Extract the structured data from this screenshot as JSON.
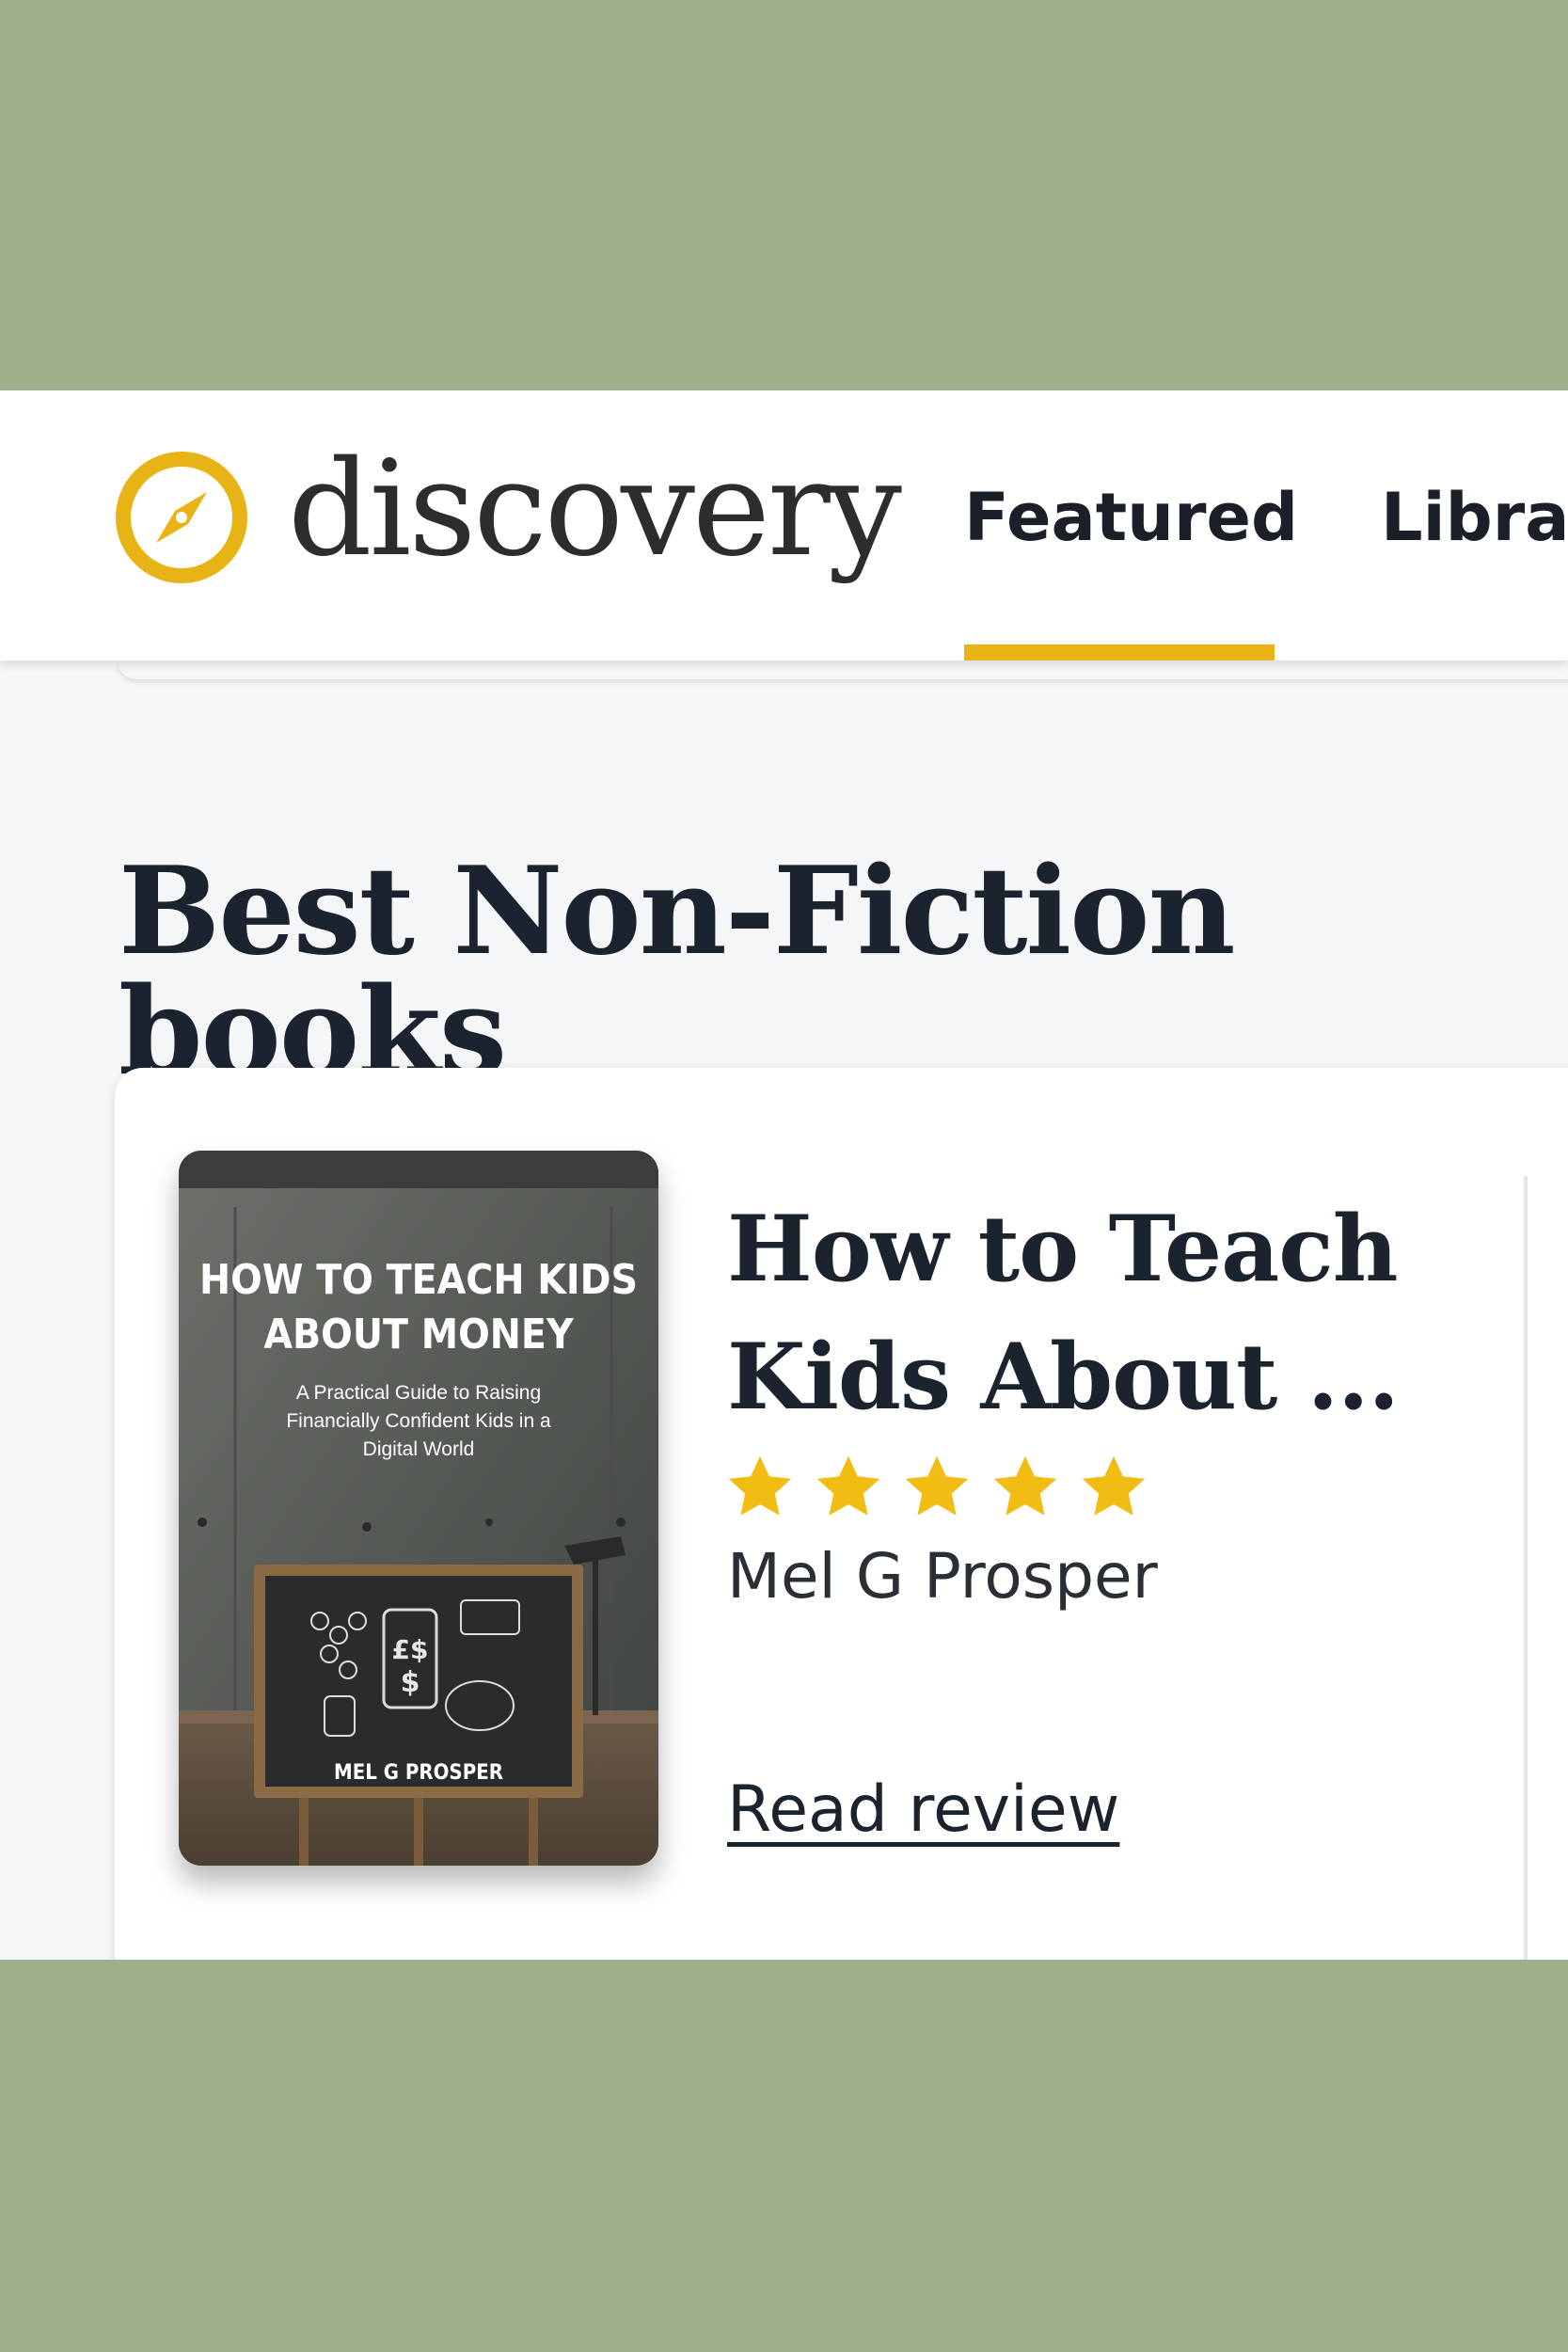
{
  "brand": {
    "name": "discovery",
    "icon": "compass-icon",
    "accent": "#e8b415"
  },
  "nav": {
    "items": [
      "Featured",
      "Library"
    ],
    "active": "Featured"
  },
  "section": {
    "title": "Best Non-Fiction books"
  },
  "book": {
    "title": "How to Teach Kids About ...",
    "author": "Mel G Prosper",
    "rating": 5,
    "rating_max": 5,
    "review_link": "Read review",
    "cover": {
      "title_line1": "HOW TO TEACH KIDS",
      "title_line2": "ABOUT MONEY",
      "subtitle_line1": "A Practical Guide to Raising",
      "subtitle_line2": "Financially Confident Kids in a",
      "subtitle_line3": "Digital World",
      "author": "MEL G PROSPER",
      "board_symbols": "£$",
      "board_dollar": "$"
    }
  },
  "colors": {
    "background": "#a0b08a",
    "page": "#f5f6f8",
    "star": "#f2bd12",
    "text": "#1a232e"
  }
}
